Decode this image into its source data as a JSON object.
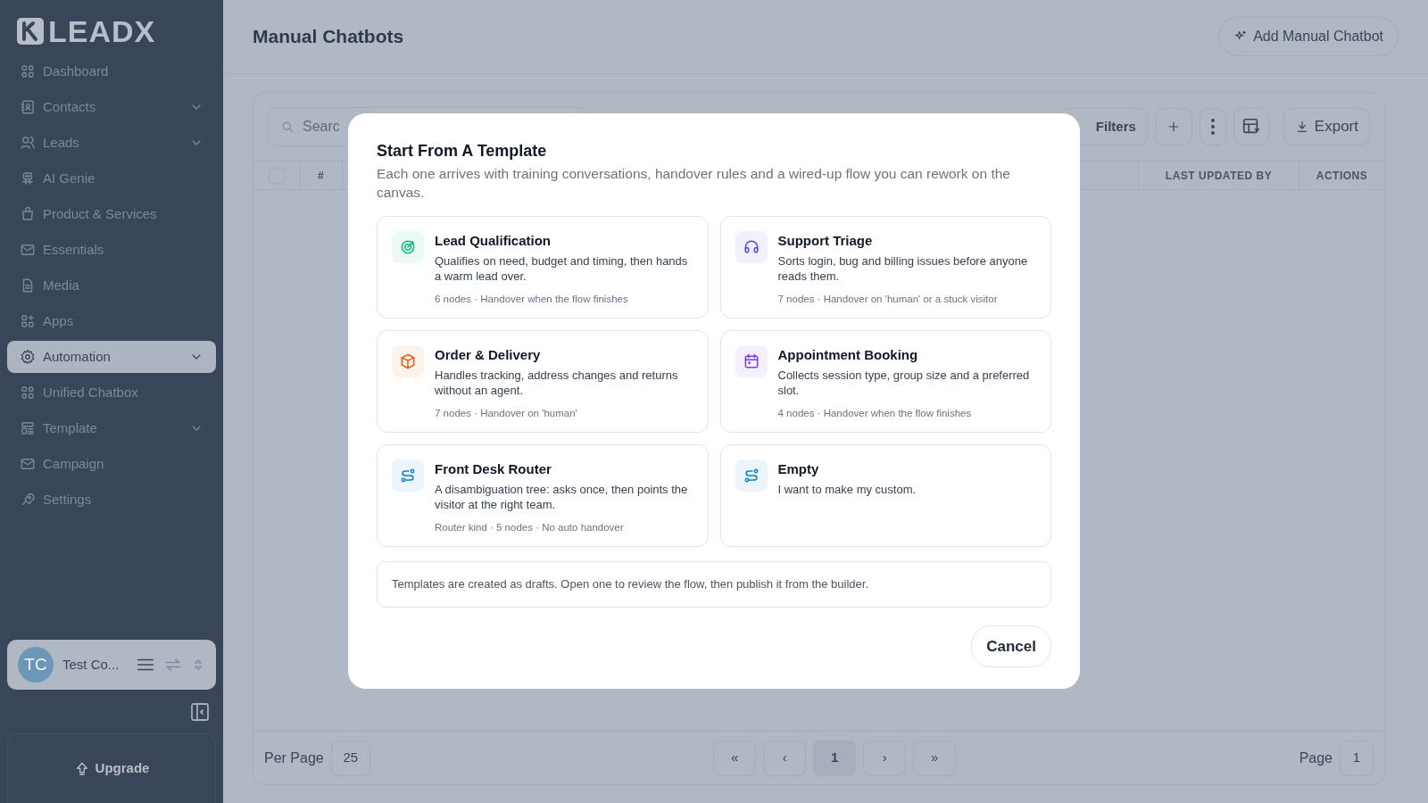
{
  "sidebar": {
    "logo": "LEADX",
    "items": [
      {
        "label": "Dashboard",
        "expandable": false,
        "selected": false
      },
      {
        "label": "Contacts",
        "expandable": true,
        "selected": false
      },
      {
        "label": "Leads",
        "expandable": true,
        "selected": false
      },
      {
        "label": "AI Genie",
        "expandable": false,
        "selected": false
      },
      {
        "label": "Product & Services",
        "expandable": false,
        "selected": false
      },
      {
        "label": "Essentials",
        "expandable": false,
        "selected": false
      },
      {
        "label": "Media",
        "expandable": false,
        "selected": false
      },
      {
        "label": "Apps",
        "expandable": false,
        "selected": false
      },
      {
        "label": "Automation",
        "expandable": true,
        "selected": true
      },
      {
        "label": "Unified Chatbox",
        "expandable": false,
        "selected": false
      },
      {
        "label": "Template",
        "expandable": true,
        "selected": false
      },
      {
        "label": "Campaign",
        "expandable": false,
        "selected": false
      },
      {
        "label": "Settings",
        "expandable": false,
        "selected": false
      }
    ],
    "profile": {
      "initials": "TC",
      "name": "Test Co..."
    },
    "upgrade": "Upgrade"
  },
  "header": {
    "title": "Manual Chatbots",
    "add_button": "Add Manual Chatbot"
  },
  "toolbar": {
    "search_placeholder": "Searc",
    "filters": "Filters",
    "export": "Export"
  },
  "table": {
    "select_all_checked": false,
    "columns": [
      "#",
      "LAST UPDATED BY",
      "ACTIONS"
    ]
  },
  "pagination": {
    "per_page_label": "Per Page",
    "per_page": "25",
    "first": "«",
    "prev": "‹",
    "page": "1",
    "next": "›",
    "last": "»",
    "page_label": "Page",
    "page_value": "1"
  },
  "modal": {
    "title": "Start From A Template",
    "subtitle": "Each one arrives with training conversations, handover rules and a wired-up flow you can rework on the canvas.",
    "templates": [
      {
        "kind": "target",
        "color": "#10b981",
        "title": "Lead Qualification",
        "description": "Qualifies on need, budget and timing, then hands a warm lead over.",
        "meta": "6 nodes · Handover when the flow finishes"
      },
      {
        "kind": "headset",
        "color": "#4f46e5",
        "title": "Support Triage",
        "description": "Sorts login, bug and billing issues before anyone reads them.",
        "meta": "7 nodes · Handover on 'human' or a stuck visitor"
      },
      {
        "kind": "box",
        "color": "#ea580c",
        "title": "Order & Delivery",
        "description": "Handles tracking, address changes and returns without an agent.",
        "meta": "7 nodes · Handover on 'human'"
      },
      {
        "kind": "calendar",
        "color": "#7c3aed",
        "title": "Appointment Booking",
        "description": "Collects session type, group size and a preferred slot.",
        "meta": "4 nodes · Handover when the flow finishes"
      },
      {
        "kind": "route",
        "color": "#0284c7",
        "title": "Front Desk Router",
        "description": "A disambiguation tree: asks once, then points the visitor at the right team.",
        "meta": "Router kind · 5 nodes · No auto handover"
      },
      {
        "kind": "route",
        "color": "#0284c7",
        "title": "Empty",
        "description": "I want to make my custom."
      }
    ],
    "note": "Templates are created as drafts. Open one to review the flow, then publish it from the builder.",
    "cancel": "Cancel"
  }
}
